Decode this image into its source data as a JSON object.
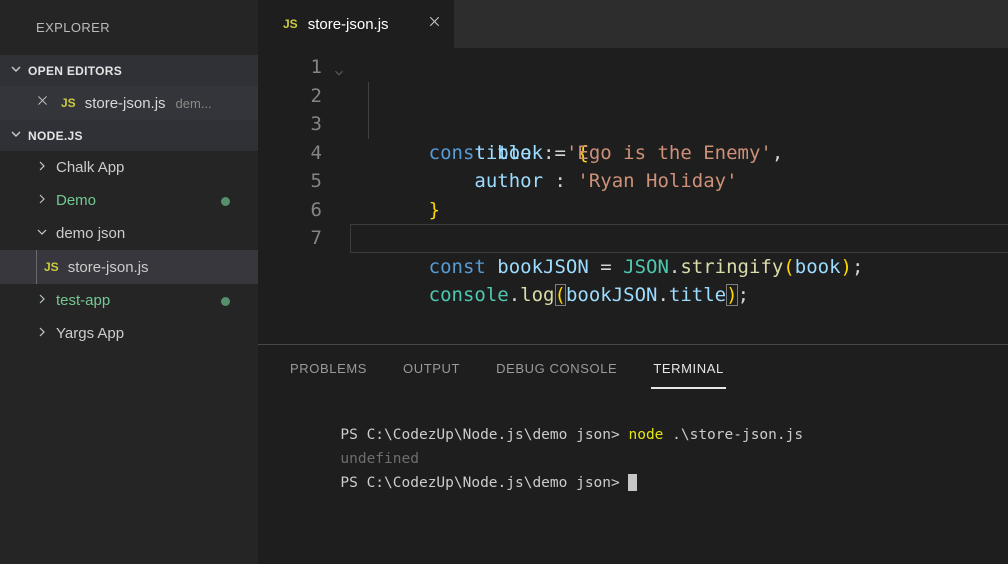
{
  "sidebar": {
    "title": "EXPLORER",
    "open_editors_label": "OPEN EDITORS",
    "open_editor": {
      "file": "store-json.js",
      "folder_hint": "dem..."
    },
    "root_label": "NODE.JS",
    "tree": [
      {
        "label": "Chalk App"
      },
      {
        "label": "Demo"
      },
      {
        "label": "demo json"
      },
      {
        "label": "store-json.js"
      },
      {
        "label": "test-app"
      },
      {
        "label": "Yargs App"
      }
    ]
  },
  "icons": {
    "js": "JS"
  },
  "editor": {
    "tab_title": "store-json.js",
    "lines": [
      {
        "num": "1",
        "tokens": [
          {
            "t": "const ",
            "c": "keyword"
          },
          {
            "t": "book ",
            "c": "variable"
          },
          {
            "t": "= ",
            "c": "punct"
          },
          {
            "t": "{",
            "c": "bracket"
          }
        ]
      },
      {
        "num": "2",
        "tokens": [
          {
            "t": "    ",
            "c": "punct"
          },
          {
            "t": "title ",
            "c": "variable"
          },
          {
            "t": ": ",
            "c": "punct"
          },
          {
            "t": "'Ego is the Enemy'",
            "c": "string"
          },
          {
            "t": ",",
            "c": "punct"
          }
        ]
      },
      {
        "num": "3",
        "tokens": [
          {
            "t": "    ",
            "c": "punct"
          },
          {
            "t": "author ",
            "c": "variable"
          },
          {
            "t": ": ",
            "c": "punct"
          },
          {
            "t": "'Ryan Holiday'",
            "c": "string"
          }
        ]
      },
      {
        "num": "4",
        "tokens": [
          {
            "t": "}",
            "c": "bracket"
          }
        ]
      },
      {
        "num": "5",
        "tokens": []
      },
      {
        "num": "6",
        "tokens": [
          {
            "t": "const ",
            "c": "keyword"
          },
          {
            "t": "bookJSON ",
            "c": "variable"
          },
          {
            "t": "= ",
            "c": "punct"
          },
          {
            "t": "JSON",
            "c": "type"
          },
          {
            "t": ".",
            "c": "punct"
          },
          {
            "t": "stringify",
            "c": "func"
          },
          {
            "t": "(",
            "c": "bracket"
          },
          {
            "t": "book",
            "c": "variable"
          },
          {
            "t": ")",
            "c": "bracket"
          },
          {
            "t": ";",
            "c": "punct"
          }
        ]
      },
      {
        "num": "7",
        "tokens": [
          {
            "t": "console",
            "c": "type"
          },
          {
            "t": ".",
            "c": "punct"
          },
          {
            "t": "log",
            "c": "func"
          },
          {
            "t": "(",
            "c": "bracket matched"
          },
          {
            "t": "bookJSON",
            "c": "variable"
          },
          {
            "t": ".",
            "c": "punct"
          },
          {
            "t": "title",
            "c": "variable"
          },
          {
            "t": ")",
            "c": "bracket matched"
          },
          {
            "t": ";",
            "c": "punct"
          }
        ]
      }
    ]
  },
  "panel": {
    "tabs": [
      {
        "label": "PROBLEMS"
      },
      {
        "label": "OUTPUT"
      },
      {
        "label": "DEBUG CONSOLE"
      },
      {
        "label": "TERMINAL"
      }
    ],
    "terminal": {
      "lines": [
        [
          {
            "t": "PS C:\\CodezUp\\Node.js\\demo json> ",
            "c": "t-fg"
          },
          {
            "t": "node",
            "c": "t-cmd"
          },
          {
            "t": " .\\store-json.js",
            "c": "t-fg"
          }
        ],
        [
          {
            "t": "undefined",
            "c": "t-dim"
          }
        ],
        [
          {
            "t": "PS C:\\CodezUp\\Node.js\\demo json> ",
            "c": "t-fg"
          }
        ]
      ]
    }
  },
  "colors": {
    "editor_bg": "#1e1e1e",
    "sidebar_bg": "#252526",
    "selected_row_bg": "#37373d",
    "keyword": "#569cd6",
    "variable": "#9cdcfe",
    "string": "#ce9178",
    "type": "#4ec9b0",
    "function": "#dcdcaa",
    "bracket": "#ffd700",
    "js_icon": "#cbcb41",
    "git_modified": "#73c991",
    "terminal_command": "#e5e510"
  }
}
